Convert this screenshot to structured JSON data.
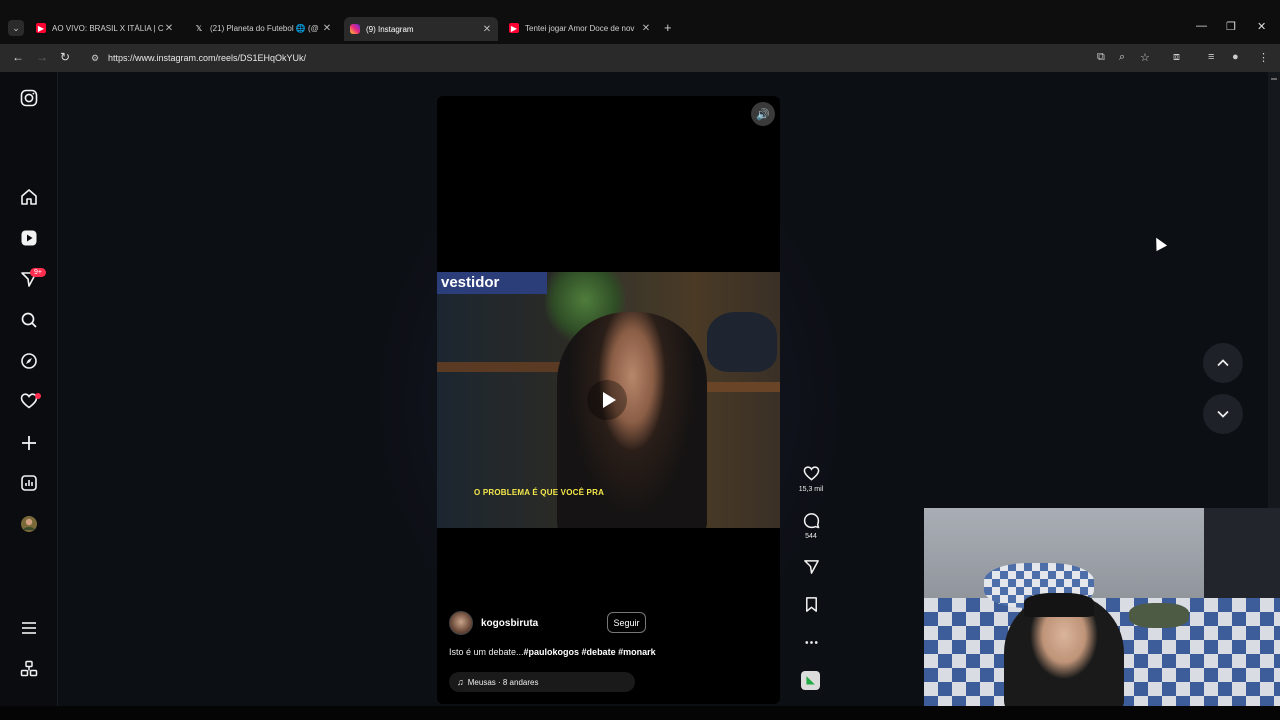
{
  "browser": {
    "tabs": [
      {
        "title": "AO VIVO: BRASIL X ITÁLIA | CO",
        "favicon": "youtube-icon",
        "color": "#ff0033"
      },
      {
        "title": "(21) Planeta do Futebol 🌐 (@",
        "favicon": "x-icon",
        "color": "#ffffff"
      },
      {
        "title": "(9) Instagram",
        "favicon": "instagram-icon",
        "color": "#e1306c",
        "active": true
      },
      {
        "title": "Tentei jogar Amor Doce de nov",
        "favicon": "youtube-icon",
        "color": "#ff0033"
      }
    ],
    "url": "https://www.instagram.com/reels/DS1EHqOkYUk/"
  },
  "sidebar": {
    "notifications_badge": "9+",
    "items": [
      {
        "name": "instagram-logo-icon"
      },
      {
        "name": "home-icon"
      },
      {
        "name": "reels-icon"
      },
      {
        "name": "direct-messages-icon"
      },
      {
        "name": "search-icon"
      },
      {
        "name": "explore-icon"
      },
      {
        "name": "notifications-icon"
      },
      {
        "name": "create-icon"
      },
      {
        "name": "dashboard-icon"
      },
      {
        "name": "profile-avatar"
      },
      {
        "name": "more-menu-icon"
      },
      {
        "name": "also-from-meta-icon"
      }
    ]
  },
  "reel": {
    "caption_overlay": "O PROBLEMA É QUE VOCÊ PRA",
    "banner_text": "vestidor",
    "author": "kogosbiruta",
    "follow_label": "Seguir",
    "description_prefix": "Isto é um debate...",
    "description_tags": "#paulokogos #debate #monark",
    "audio": "Meusas · 8 andares",
    "likes": "15,3 mil",
    "comments": "544"
  },
  "colors": {
    "accent_red": "#ff2e4f",
    "caption_yellow": "#f5e84a",
    "page_bg": "#0c0f14"
  }
}
